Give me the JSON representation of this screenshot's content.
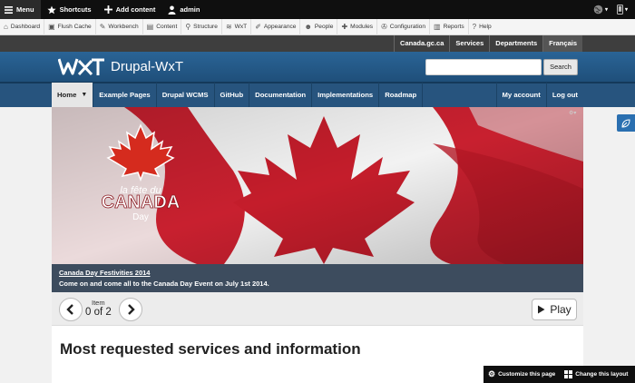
{
  "admin_bar": {
    "menu": "Menu",
    "shortcuts": "Shortcuts",
    "add_content": "Add content",
    "user": "admin"
  },
  "tray": {
    "items": [
      {
        "label": "Dashboard",
        "icon": "dashboard-icon"
      },
      {
        "label": "Flush Cache",
        "icon": "flush-cache-icon"
      },
      {
        "label": "Workbench",
        "icon": "workbench-icon"
      },
      {
        "label": "Content",
        "icon": "content-icon"
      },
      {
        "label": "Structure",
        "icon": "structure-icon"
      },
      {
        "label": "WxT",
        "icon": "wxt-icon"
      },
      {
        "label": "Appearance",
        "icon": "appearance-icon"
      },
      {
        "label": "People",
        "icon": "people-icon"
      },
      {
        "label": "Modules",
        "icon": "modules-icon"
      },
      {
        "label": "Configuration",
        "icon": "configuration-icon"
      },
      {
        "label": "Reports",
        "icon": "reports-icon"
      },
      {
        "label": "Help",
        "icon": "help-icon"
      }
    ]
  },
  "gc_bar": {
    "links": [
      "Canada.gc.ca",
      "Services",
      "Departments"
    ],
    "language": "Français"
  },
  "header": {
    "site_name": "Drupal-WxT",
    "logo_text": "WxT",
    "search_button": "Search",
    "search_value": ""
  },
  "nav": {
    "home": "Home",
    "items": [
      "Example Pages",
      "Drupal WCMS",
      "GitHub",
      "Documentation",
      "Implementations",
      "Roadmap"
    ],
    "right_items": [
      "My account",
      "Log out"
    ]
  },
  "hero": {
    "badge_line1": "la fête du",
    "badge_line2": "CANADA",
    "badge_line3": "Day",
    "colors": {
      "red": "#c8202f",
      "white": "#f4f4f4"
    }
  },
  "caption": {
    "title": "Canada Day Festivities 2014",
    "text": "Come on and come all to the Canada Day Event on July 1st 2014."
  },
  "controls": {
    "item_label": "Item",
    "item_count": "0 of 2",
    "play_label": "Play"
  },
  "content": {
    "heading": "Most requested services and information"
  },
  "panels_bar": {
    "customize": "Customize this page",
    "change_layout": "Change this layout"
  }
}
